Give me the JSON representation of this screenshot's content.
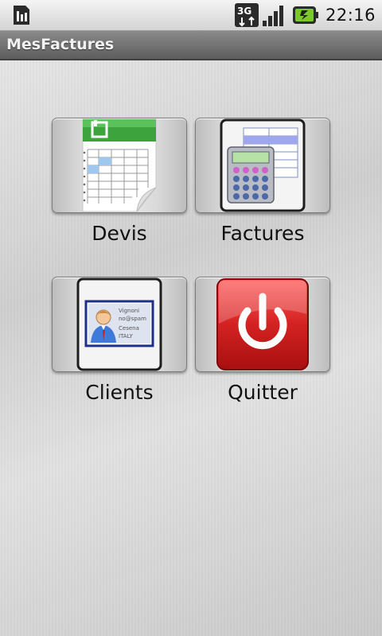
{
  "status_bar": {
    "network_type": "3G",
    "time": "22:16",
    "icons": [
      "sim-card-icon",
      "3g-data-icon",
      "signal-strength-icon",
      "battery-charging-icon"
    ]
  },
  "app": {
    "title": "MesFactures"
  },
  "menu": [
    {
      "id": "devis",
      "label": "Devis",
      "icon": "spreadsheet-document-icon"
    },
    {
      "id": "factures",
      "label": "Factures",
      "icon": "calculator-invoice-icon"
    },
    {
      "id": "clients",
      "label": "Clients",
      "icon": "business-card-icon"
    },
    {
      "id": "quitter",
      "label": "Quitter",
      "icon": "power-icon"
    }
  ],
  "business_card": {
    "name": "Vignoni",
    "email": "no@spam",
    "city": "Cesena",
    "country": "ITALY"
  },
  "colors": {
    "title_bar": "#6f6f6f",
    "power_red": "#d42222",
    "spreadsheet_green": "#3da33d",
    "card_blue": "#1e2f8a"
  }
}
